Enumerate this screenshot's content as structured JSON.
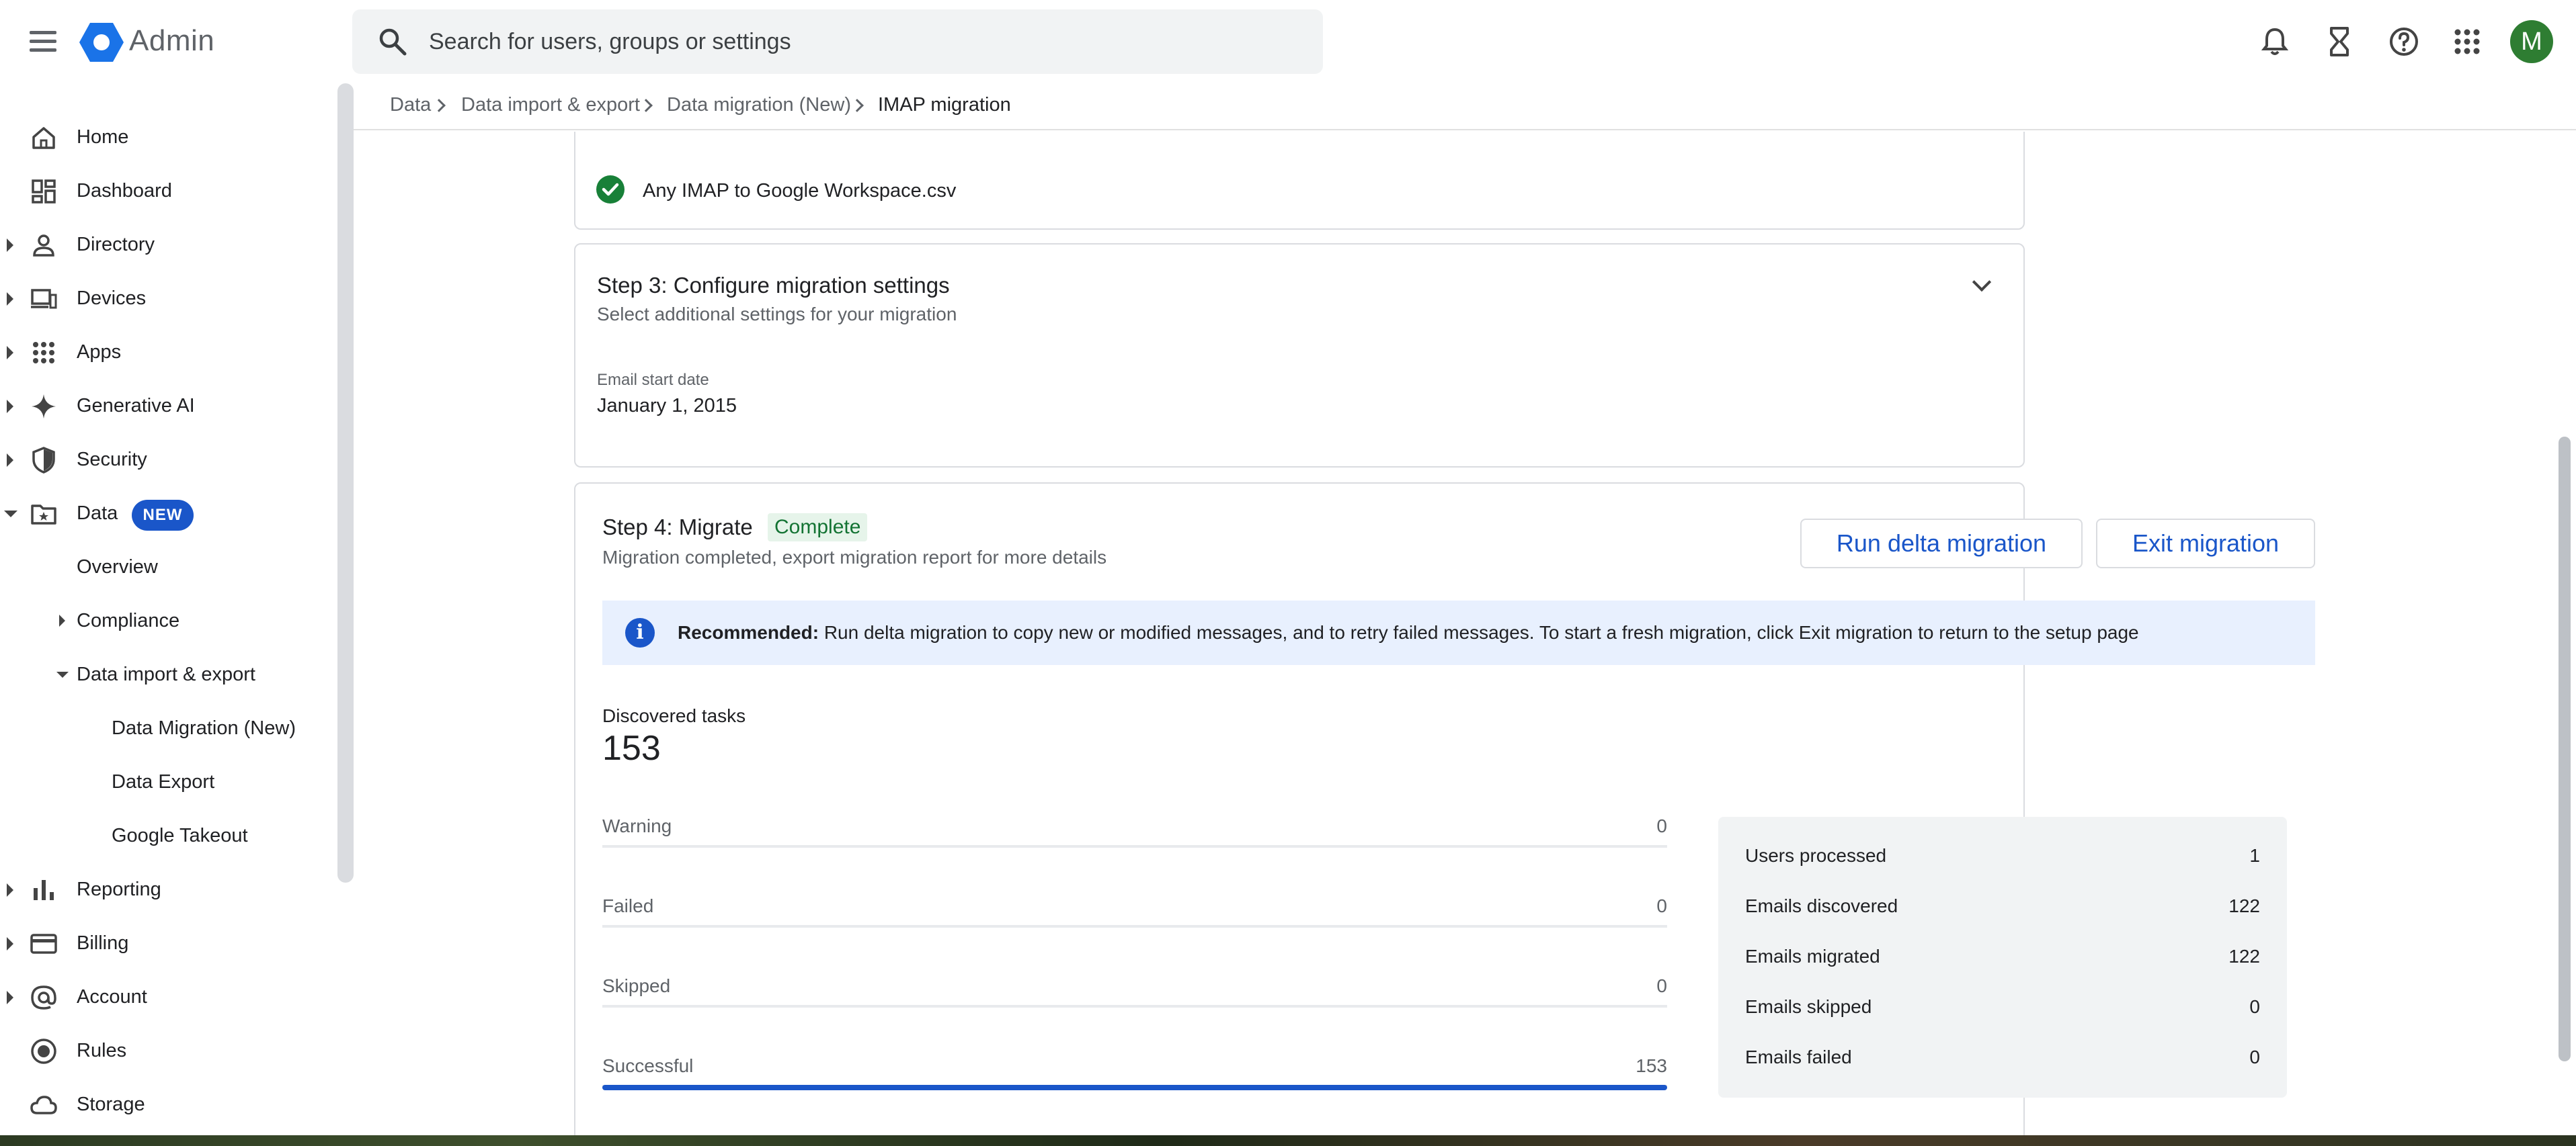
{
  "app": {
    "title": "Admin",
    "avatar_letter": "M"
  },
  "search": {
    "placeholder": "Search for users, groups or settings"
  },
  "sidebar": {
    "items": [
      {
        "label": "Home",
        "icon": "home-icon"
      },
      {
        "label": "Dashboard",
        "icon": "dashboard-icon"
      },
      {
        "label": "Directory",
        "icon": "person-icon"
      },
      {
        "label": "Devices",
        "icon": "devices-icon"
      },
      {
        "label": "Apps",
        "icon": "apps-grid-icon"
      },
      {
        "label": "Generative AI",
        "icon": "sparkle-icon"
      },
      {
        "label": "Security",
        "icon": "shield-icon"
      },
      {
        "label": "Data",
        "icon": "data-folder-icon",
        "badge": "NEW"
      },
      {
        "label": "Overview"
      },
      {
        "label": "Compliance"
      },
      {
        "label": "Data import & export"
      },
      {
        "label": "Data Migration (New)"
      },
      {
        "label": "Data Export"
      },
      {
        "label": "Google Takeout"
      },
      {
        "label": "Reporting",
        "icon": "bar-chart-icon"
      },
      {
        "label": "Billing",
        "icon": "credit-card-icon"
      },
      {
        "label": "Account",
        "icon": "at-sign-icon"
      },
      {
        "label": "Rules",
        "icon": "rules-icon"
      },
      {
        "label": "Storage",
        "icon": "cloud-icon"
      }
    ]
  },
  "breadcrumb": [
    "Data",
    "Data import & export",
    "Data migration (New)",
    "IMAP migration"
  ],
  "step2": {
    "file_name": "Any IMAP to Google Workspace.csv"
  },
  "step3": {
    "title": "Step 3: Configure migration settings",
    "subtitle": "Select additional settings for your migration",
    "field_label": "Email start date",
    "field_value": "January 1, 2015"
  },
  "step4": {
    "title": "Step 4: Migrate",
    "status": "Complete",
    "subtitle": "Migration completed, export migration report for more details",
    "run_delta_label": "Run delta migration",
    "exit_label": "Exit migration",
    "banner_bold": "Recommended:",
    "banner_text": " Run delta migration to copy new or modified messages, and to retry failed messages. To start a fresh migration, click Exit migration to return to the setup page",
    "discovered_label": "Discovered tasks",
    "discovered_value": "153",
    "stats": [
      {
        "label": "Warning",
        "value": "0",
        "fraction": 0
      },
      {
        "label": "Failed",
        "value": "0",
        "fraction": 0
      },
      {
        "label": "Skipped",
        "value": "0",
        "fraction": 0
      },
      {
        "label": "Successful",
        "value": "153",
        "fraction": 1
      }
    ],
    "summary": [
      {
        "label": "Users processed",
        "value": "1"
      },
      {
        "label": "Emails discovered",
        "value": "122"
      },
      {
        "label": "Emails migrated",
        "value": "122"
      },
      {
        "label": "Emails skipped",
        "value": "0"
      },
      {
        "label": "Emails failed",
        "value": "0"
      }
    ]
  },
  "colors": {
    "accent": "#1a56c9",
    "success": "#188038",
    "complete_bg": "#e6f4ea",
    "banner_bg": "#e8f0fe"
  }
}
